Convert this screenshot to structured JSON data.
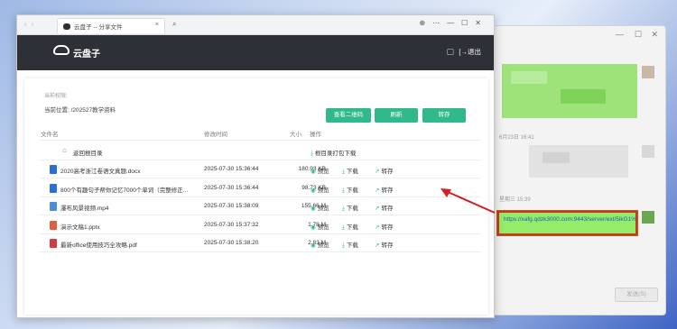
{
  "browser": {
    "tab_title": "云盘子 -- 分享文件",
    "tab_close": "×"
  },
  "app": {
    "brand": "云盘子",
    "logout": "[→退出"
  },
  "share": {
    "current_dir_label": "当前权限:",
    "location": "当前位置: /202527教学资料",
    "buttons": {
      "qr": "查看二维码",
      "refresh": "刷新",
      "save": "转存"
    },
    "columns": {
      "name": "文件名",
      "modified": "修改时间",
      "size": "大小",
      "actions": "操作"
    },
    "root_link": "返回根目录",
    "root_download": "根目录打包下载",
    "action_labels": {
      "preview": "预览",
      "download": "下载",
      "save": "转存"
    },
    "files": [
      {
        "name": "2020高考浙江卷语文真题.docx",
        "modified": "2025-07-30 15:36:44",
        "size": "180.93 KB",
        "type": "docx"
      },
      {
        "name": "800个有趣句子帮你记忆7000个单词（完整修正...",
        "modified": "2025-07-30 15:36:44",
        "size": "98.73 KB",
        "type": "docx"
      },
      {
        "name": "瀑布风景视频.mp4",
        "modified": "2025-07-30 15:38:09",
        "size": "155.66 M",
        "type": "mp4"
      },
      {
        "name": "演示文稿1.pptx",
        "modified": "2025-07-30 15:37:32",
        "size": "1.78 M",
        "type": "pptx"
      },
      {
        "name": "最新office使用技巧全攻略.pdf",
        "modified": "2025-07-30 15:38:20",
        "size": "2.83 M",
        "type": "pdf"
      }
    ]
  },
  "chat": {
    "time1": "6月23日 16:41",
    "time2": "星期三 15:39",
    "message": "https://xafg.qdzk3000.com:9443/server/ext/5ikG1%23LOnoo%40",
    "send_button": "发送(S)"
  },
  "colors": {
    "accent": "#30b98a",
    "appbar": "#2d3036",
    "chat_bubble": "#95ec69",
    "highlight_border": "#c0392b"
  }
}
